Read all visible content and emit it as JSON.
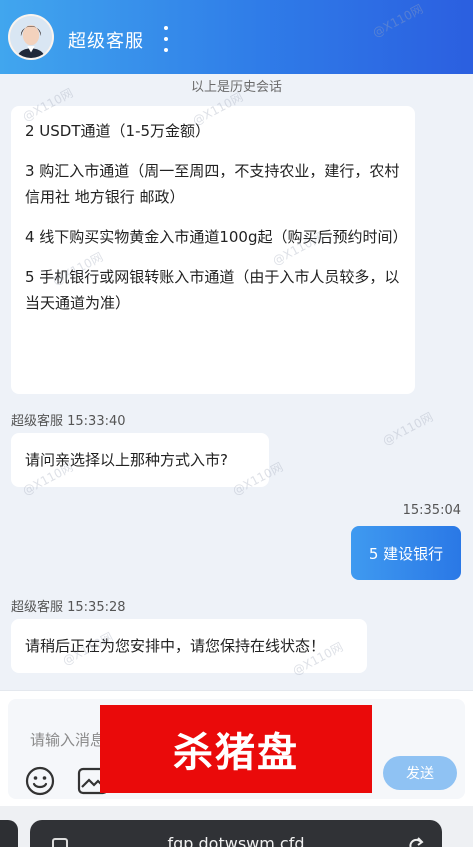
{
  "header": {
    "title": "超级客服"
  },
  "chat": {
    "history_note": "以上是历史会话",
    "options_message": [
      "2 USDT通道（1-5万金额）",
      "3 购汇入市通道（周一至周四，不支持农业，建行，农村信用社 地方银行 邮政）",
      "4 线下购买实物黄金入市通道100g起（购买后预约时间）",
      "5 手机银行或网银转账入市通道（由于入市人员较多，以当天通道为准）"
    ],
    "agent_meta_1": "超级客服 15:33:40",
    "agent_question": "请问亲选择以上那种方式入市?",
    "user_time": "15:35:04",
    "user_reply": "5 建设银行",
    "agent_meta_2": "超级客服 15:35:28",
    "agent_reply": "请稍后正在为您安排中，请您保持在线状态！"
  },
  "composer": {
    "placeholder": "请输入消息",
    "send_label": "发送"
  },
  "overlay": {
    "label": "杀猪盘",
    "color": "#ea0a0a"
  },
  "browser": {
    "url": "fqp.dotwswm.cfd"
  },
  "watermark": {
    "text": "@X110网"
  },
  "colors": {
    "header_gradient_start": "#41a6ee",
    "header_gradient_end": "#2b5fe0",
    "user_bubble": "#2a78e6",
    "send_button": "#8fc2f3"
  }
}
